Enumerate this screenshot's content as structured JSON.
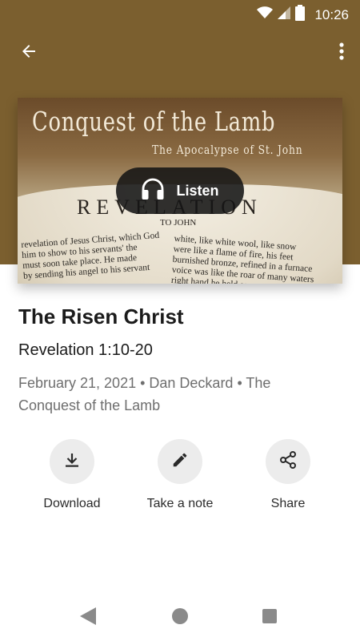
{
  "status_bar": {
    "time": "10:26",
    "icons": [
      "wifi-icon",
      "cellular-signal-icon",
      "battery-icon"
    ]
  },
  "app_bar": {
    "back_icon": "arrow-left-icon",
    "more_icon": "more-vertical-icon"
  },
  "artwork": {
    "title": "Conquest of the Lamb",
    "subtitle": "The Apocalypse of St. John",
    "book_heading": "REVELATION",
    "book_subheading": "TO JOHN",
    "left_column_lines": [
      "revelation of Jesus Christ, which God",
      "him to show to his servants' the",
      "must soon take place. He made",
      "by sending his angel to his servant"
    ],
    "right_column_lines": [
      "white, like white wool, like snow",
      "were like a flame of fire, his feet",
      "burnished bronze, refined in a furnace",
      "voice was like the roar of many waters",
      "right hand he held seven stars"
    ]
  },
  "listen_button": {
    "label": "Listen",
    "icon": "headphones-icon"
  },
  "episode": {
    "title": "The Risen Christ",
    "scripture": "Revelation 1:10-20",
    "meta": "February 21, 2021 • Dan Deckard • The Conquest of the Lamb"
  },
  "actions": [
    {
      "label": "Download",
      "icon": "download-icon"
    },
    {
      "label": "Take a note",
      "icon": "pencil-icon"
    },
    {
      "label": "Share",
      "icon": "share-icon"
    }
  ],
  "colors": {
    "header_background": "#7b5f2f",
    "listen_button": "#1c1c1c",
    "action_circle": "#ececec",
    "meta_text": "#6e6e6e"
  }
}
